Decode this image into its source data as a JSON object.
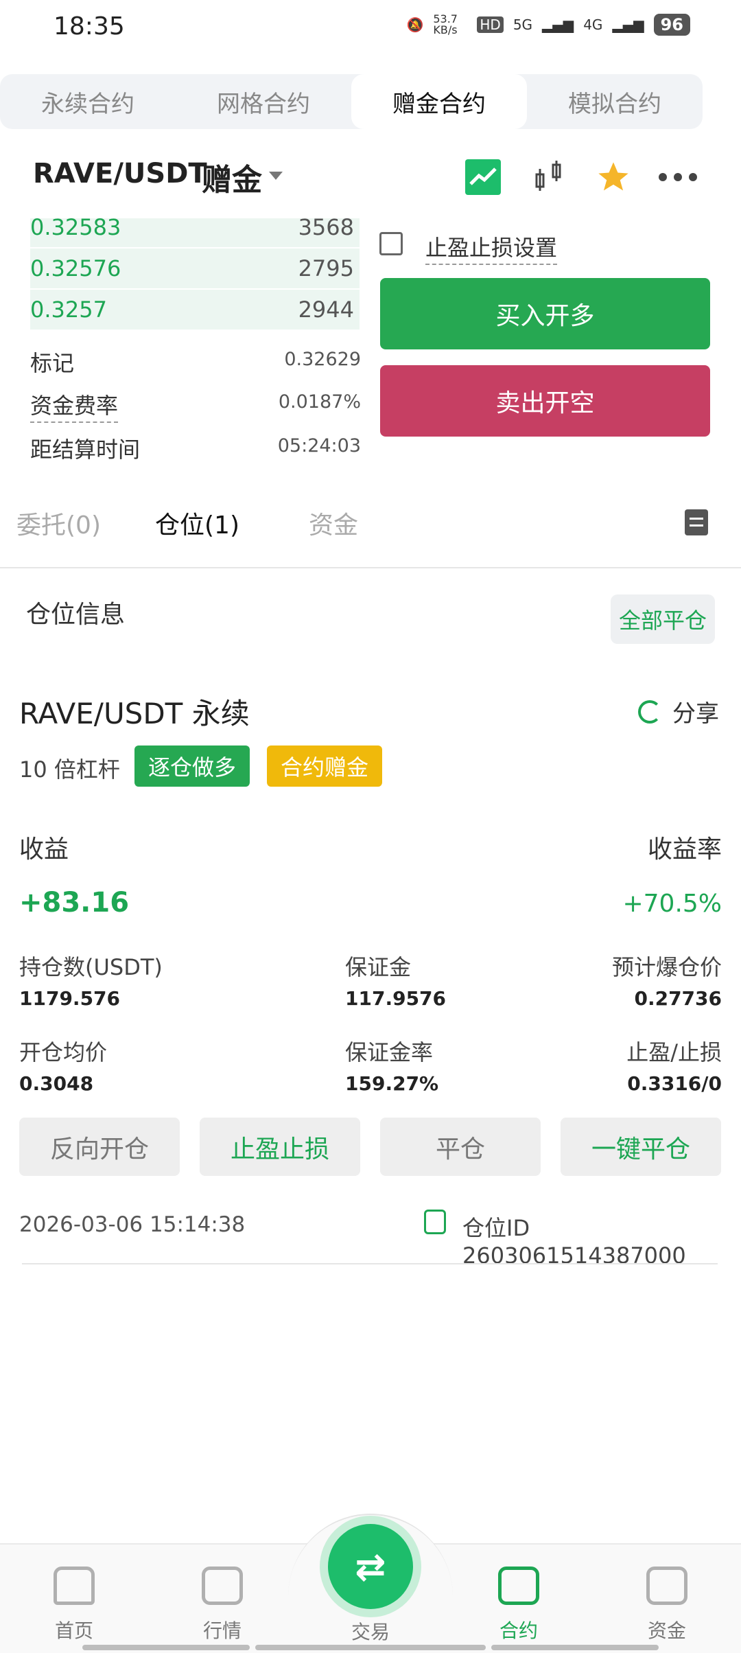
{
  "status_bar": {
    "time": "18:35",
    "net_speed": "53.7 KB/s",
    "signal_5g": "5G",
    "signal_4g": "4G",
    "battery": "96"
  },
  "contract_tabs": [
    "永续合约",
    "网格合约",
    "赠金合约",
    "模拟合约"
  ],
  "header": {
    "pair": "RAVE/USDT",
    "bonus_label": "赠金",
    "icons": [
      "chart-line-icon",
      "candlestick-icon",
      "star-icon",
      "more-icon"
    ]
  },
  "orderbook": [
    {
      "price": "0.32583",
      "qty": "3568"
    },
    {
      "price": "0.32576",
      "qty": "2795"
    },
    {
      "price": "0.3257",
      "qty": "2944"
    }
  ],
  "market_info": {
    "mark_label": "标记",
    "mark_value": "0.32629",
    "funding_label": "资金费率",
    "funding_value": "0.0187%",
    "settle_label": "距结算时间",
    "settle_value": "05:24:03"
  },
  "trade": {
    "tpsl_label": "止盈止损设置",
    "buy_label": "买入开多",
    "sell_label": "卖出开空"
  },
  "position_tabs": {
    "orders": "委托(0)",
    "positions": "仓位(1)",
    "funds": "资金"
  },
  "position_section": {
    "title": "仓位信息",
    "close_all": "全部平仓"
  },
  "position": {
    "name": "RAVE/USDT 永续",
    "share": "分享",
    "leverage": "10 倍杠杆",
    "badge_mode": "逐仓做多",
    "badge_bonus": "合约赠金",
    "pnl_label": "收益",
    "pnl_value": "+83.16",
    "roe_label": "收益率",
    "roe_value": "+70.5%",
    "size_label": "持仓数(USDT)",
    "size_value": "1179.576",
    "margin_label": "保证金",
    "margin_value": "117.9576",
    "liq_label": "预计爆仓价",
    "liq_value": "0.27736",
    "entry_label": "开仓均价",
    "entry_value": "0.3048",
    "margin_rate_label": "保证金率",
    "margin_rate_value": "159.27%",
    "tpsl_label": "止盈/止损",
    "tpsl_value": "0.3316/0",
    "actions": [
      "反向开仓",
      "止盈止损",
      "平仓",
      "一键平仓"
    ],
    "timestamp": "2026-03-06 15:14:38",
    "position_id": "仓位ID 2603061514387000"
  },
  "bottom_nav": [
    "首页",
    "行情",
    "交易",
    "合约",
    "资金"
  ],
  "colors": {
    "green": "#1da653",
    "red": "#c63f63",
    "yellow": "#f0b90b"
  }
}
